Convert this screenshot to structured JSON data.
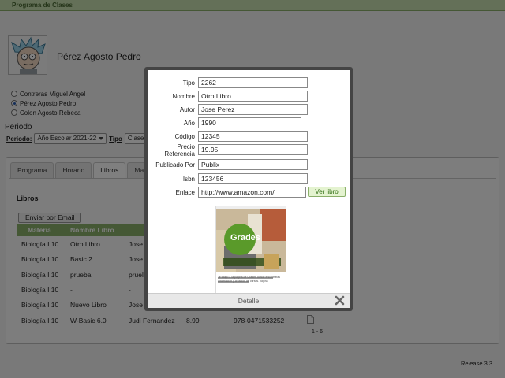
{
  "app": {
    "header": "Programa de Clases",
    "release": "Release 3.3"
  },
  "person": {
    "name": "Pérez Agosto Pedro"
  },
  "students": [
    {
      "label": "Contreras Miguel Angel",
      "selected": false
    },
    {
      "label": "Pérez Agosto Pedro",
      "selected": true
    },
    {
      "label": "Colon Agosto Rebeca",
      "selected": false
    }
  ],
  "periodo": {
    "title": "Periodo",
    "periodo_label": "Periodo:",
    "periodo_value": "Año Escolar 2021-22",
    "tipo_label": "Tipo",
    "tipo_value": "Clases"
  },
  "tabs": [
    "Programa",
    "Horario",
    "Libros",
    "Ma"
  ],
  "libros": {
    "heading": "Libros",
    "email_button": "Enviar por Email",
    "columns": [
      "Materia",
      "Nombre Libro"
    ],
    "rows": [
      {
        "materia": "Biología I 10",
        "nombre": "Otro Libro",
        "autor": "Jose",
        "precio": "",
        "isbn": ""
      },
      {
        "materia": "Biología I 10",
        "nombre": "Basic 2",
        "autor": "Jose",
        "precio": "",
        "isbn": ""
      },
      {
        "materia": "Biología I 10",
        "nombre": "prueba",
        "autor": "pruel",
        "precio": "",
        "isbn": ""
      },
      {
        "materia": "Biología I 10",
        "nombre": "-",
        "autor": "-",
        "precio": "",
        "isbn": ""
      },
      {
        "materia": "Biología I 10",
        "nombre": "Nuevo Libro",
        "autor": "Jose",
        "precio": "",
        "isbn": ""
      },
      {
        "materia": "Biología I 10",
        "nombre": "W-Basic 6.0",
        "autor": "Judi Fernandez",
        "precio": "8.99",
        "isbn": "978-0471533252"
      }
    ],
    "pager": "1 - 6"
  },
  "modal": {
    "fields": [
      {
        "label": "Tipo",
        "value": "2262"
      },
      {
        "label": "Nombre",
        "value": "Otro Libro"
      },
      {
        "label": "Autor",
        "value": "Jose Perez"
      },
      {
        "label": "Año",
        "value": "1990"
      },
      {
        "label": "Código",
        "value": "12345"
      },
      {
        "label": "Precio Referencia",
        "value": "19.95"
      },
      {
        "label": "Publicado Por",
        "value": "Publix"
      },
      {
        "label": "Isbn",
        "value": "123456"
      },
      {
        "label": "Enlace",
        "value": "http://www.amazon.com/"
      }
    ],
    "ver_libro": "Ver libro",
    "footer": "Detalle",
    "thumb_text": "Grades",
    "thumb_caption": "Te traigo a la página de Grades donde encontrarás información y creación de cursos. página"
  },
  "colors": {
    "header_green": "#c8e0b0",
    "table_head": "#8ab06a",
    "overlay": "#000000"
  }
}
